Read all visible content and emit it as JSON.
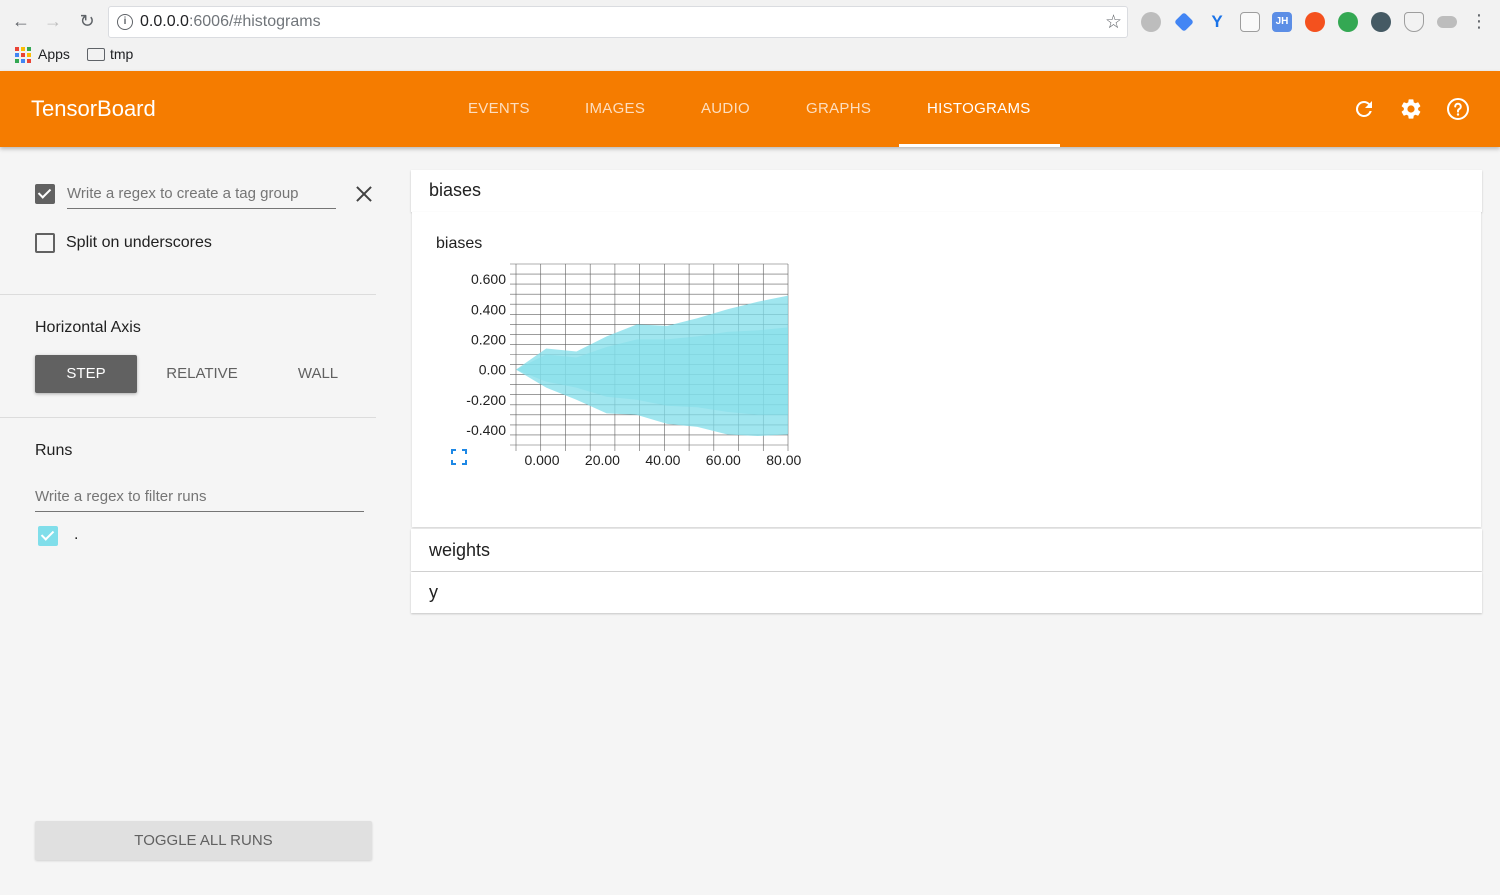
{
  "browser": {
    "url_host": "0.0.0.0",
    "url_path": ":6006/#histograms",
    "bookmarks": [
      {
        "label": "Apps",
        "icon": "apps-grid-icon"
      },
      {
        "label": "tmp",
        "icon": "folder-icon"
      }
    ]
  },
  "header": {
    "title": "TensorBoard",
    "tabs": [
      {
        "label": "EVENTS"
      },
      {
        "label": "IMAGES"
      },
      {
        "label": "AUDIO"
      },
      {
        "label": "GRAPHS"
      },
      {
        "label": "HISTOGRAMS",
        "active": true
      }
    ],
    "icons": [
      "refresh-icon",
      "settings-icon",
      "help-icon"
    ],
    "color": "#f57c00"
  },
  "sidebar": {
    "tag_group_placeholder": "Write a regex to create a tag group",
    "tag_group_checked": true,
    "split_label": "Split on underscores",
    "split_checked": false,
    "horizontal_axis_title": "Horizontal Axis",
    "axis_options": [
      {
        "label": "STEP",
        "selected": true
      },
      {
        "label": "RELATIVE",
        "selected": false
      },
      {
        "label": "WALL",
        "selected": false
      }
    ],
    "runs_title": "Runs",
    "runs_filter_placeholder": "Write a regex to filter runs",
    "runs": [
      {
        "label": ".",
        "checked": true,
        "color": "#80deea"
      }
    ],
    "toggle_all_label": "TOGGLE ALL RUNS"
  },
  "groups": [
    {
      "name": "biases",
      "expanded": true
    },
    {
      "name": "weights",
      "expanded": false
    },
    {
      "name": "y",
      "expanded": false
    }
  ],
  "chart": {
    "title": "biases",
    "fill_color": "#80deea"
  },
  "chart_data": {
    "type": "area",
    "title": "biases",
    "x_ticks": [
      "0.000",
      "20.00",
      "40.00",
      "60.00",
      "80.00"
    ],
    "y_ticks": [
      "0.600",
      "0.400",
      "0.200",
      "0.00",
      "-0.200",
      "-0.400"
    ],
    "xlim": [
      0,
      90
    ],
    "ylim": [
      -0.5,
      0.7
    ],
    "grid": true,
    "series": [
      {
        "x": [
          0,
          10,
          20,
          30,
          40,
          50,
          60,
          70,
          80,
          90
        ],
        "upper": [
          0.0,
          0.14,
          0.12,
          0.22,
          0.3,
          0.29,
          0.34,
          0.4,
          0.45,
          0.49
        ],
        "lower": [
          0.0,
          -0.12,
          -0.2,
          -0.29,
          -0.3,
          -0.36,
          -0.38,
          -0.43,
          -0.44,
          -0.43
        ],
        "upper_inner": [
          0.0,
          0.1,
          0.08,
          0.15,
          0.2,
          0.2,
          0.22,
          0.25,
          0.26,
          0.28
        ],
        "lower_inner": [
          0.0,
          -0.08,
          -0.12,
          -0.18,
          -0.2,
          -0.24,
          -0.25,
          -0.28,
          -0.3,
          -0.3
        ]
      }
    ]
  }
}
